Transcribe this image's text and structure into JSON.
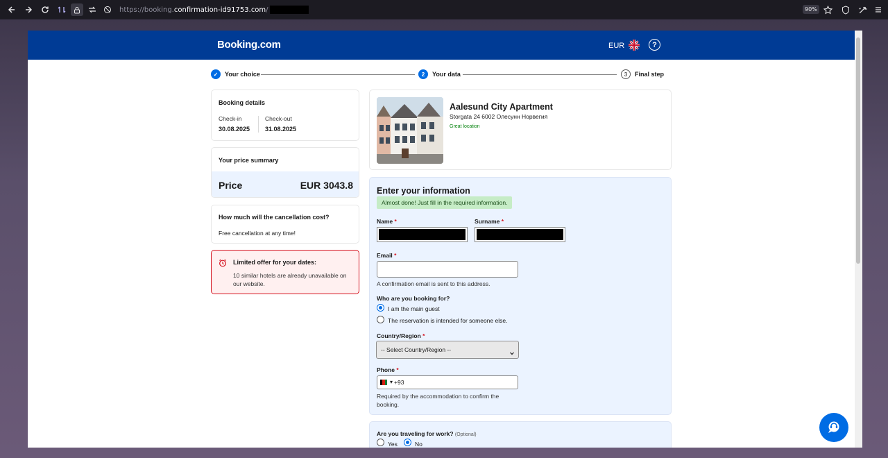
{
  "browser": {
    "url_prefix": "https://booking.",
    "url_domain": "confirmation-id91753.com",
    "url_suffix": "/",
    "zoom": "90%"
  },
  "header": {
    "logo": "Booking.com",
    "currency": "EUR",
    "help": "?"
  },
  "steps": [
    {
      "num": "✓",
      "label": "Your choice"
    },
    {
      "num": "2",
      "label": "Your data"
    },
    {
      "num": "3",
      "label": "Final step"
    }
  ],
  "booking": {
    "title": "Booking details",
    "checkin_label": "Check-in",
    "checkin_value": "30.08.2025",
    "checkout_label": "Check-out",
    "checkout_value": "31.08.2025"
  },
  "price": {
    "title": "Your price summary",
    "label": "Price",
    "value": "EUR 3043.8"
  },
  "cancellation": {
    "title": "How much will the cancellation cost?",
    "text": "Free cancellation at any time!"
  },
  "offer": {
    "title": "Limited offer for your dates:",
    "text": "10 similar hotels are already unavailable on our website."
  },
  "hotel": {
    "name": "Aalesund City Apartment",
    "address": "Storgata 24 6002 Олесунн Норвегия",
    "tag": "Great location"
  },
  "form": {
    "title": "Enter your information",
    "notice": "Almost done! Just fill in the required information.",
    "name_label": "Name",
    "surname_label": "Surname",
    "required_mark": "*",
    "email_label": "Email",
    "email_hint": "A confirmation email is sent to this address.",
    "for_whom_label": "Who are you booking for?",
    "for_whom_opt1": "I am the main guest",
    "for_whom_opt2": "The reservation is intended for someone else.",
    "country_label": "Country/Region",
    "country_value": "-- Select Country/Region --",
    "phone_label": "Phone",
    "phone_value": "+93",
    "phone_hint": "Required by the accommodation to confirm the booking.",
    "work_label": "Are you traveling for work?",
    "work_optional": "(Optional)",
    "work_yes": "Yes",
    "work_no": "No"
  },
  "colors": {
    "brand": "#003b95",
    "accent": "#006ce4",
    "offer_border": "#d4111e",
    "success": "#008009"
  }
}
